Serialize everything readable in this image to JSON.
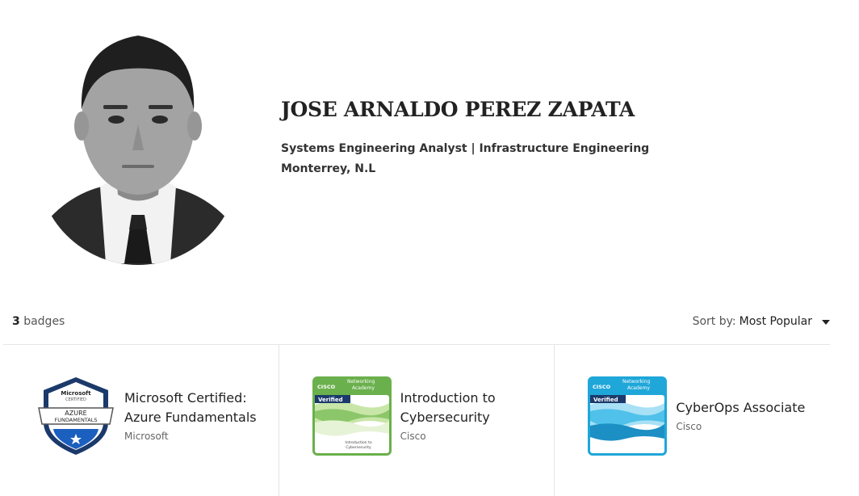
{
  "profile": {
    "name": "JOSE ARNALDO PEREZ ZAPATA",
    "headline": "Systems Engineering Analyst | Infrastructure Engineering",
    "location": "Monterrey, N.L"
  },
  "toolbar": {
    "badge_count": "3",
    "badge_count_label": "badges",
    "sort_label": "Sort by:",
    "sort_value": "Most Popular"
  },
  "badges": [
    {
      "title_line1": "Microsoft Certified:",
      "title_line2": "Azure Fundamentals",
      "issuer": "Microsoft",
      "image_text": {
        "brand": "Microsoft",
        "sub": "CERTIFIED",
        "ribbon1": "AZURE",
        "ribbon2": "FUNDAMENTALS"
      },
      "colors": {
        "shield": "#1b3a6b",
        "ribbon": "#ffffff"
      }
    },
    {
      "title_line1": "Introduction to",
      "title_line2": "Cybersecurity",
      "issuer": "Cisco",
      "image_text": {
        "brand": "CISCO",
        "program1": "Networking",
        "program2": "Academy",
        "tag": "Verified",
        "footer1": "Introduction to",
        "footer2": "Cybersecurity"
      },
      "colors": {
        "main": "#6ab04c",
        "light": "#c8e6a8"
      }
    },
    {
      "title_line1": "CyberOps Associate",
      "title_line2": "",
      "issuer": "Cisco",
      "image_text": {
        "brand": "CISCO",
        "program1": "Networking",
        "program2": "Academy",
        "tag": "Verified",
        "footer1": "CyberOps Associate"
      },
      "colors": {
        "main": "#1fa7d9",
        "light": "#a8e0f5"
      }
    }
  ]
}
